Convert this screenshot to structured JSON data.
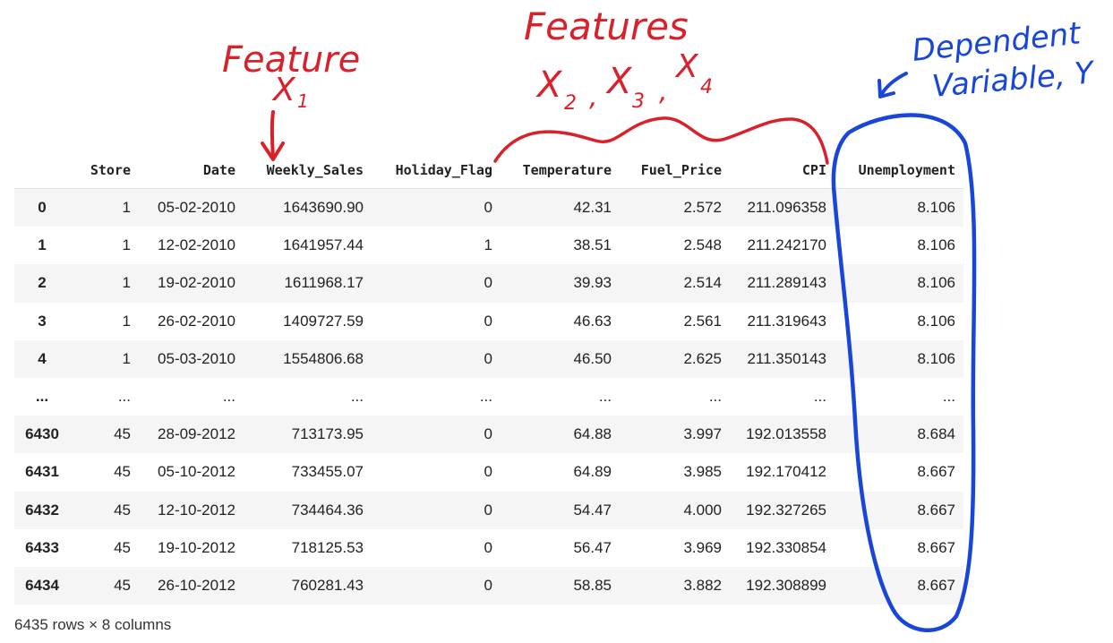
{
  "table": {
    "columns": [
      "",
      "Store",
      "Date",
      "Weekly_Sales",
      "Holiday_Flag",
      "Temperature",
      "Fuel_Price",
      "CPI",
      "Unemployment"
    ],
    "rows": [
      [
        "0",
        "1",
        "05-02-2010",
        "1643690.90",
        "0",
        "42.31",
        "2.572",
        "211.096358",
        "8.106"
      ],
      [
        "1",
        "1",
        "12-02-2010",
        "1641957.44",
        "1",
        "38.51",
        "2.548",
        "211.242170",
        "8.106"
      ],
      [
        "2",
        "1",
        "19-02-2010",
        "1611968.17",
        "0",
        "39.93",
        "2.514",
        "211.289143",
        "8.106"
      ],
      [
        "3",
        "1",
        "26-02-2010",
        "1409727.59",
        "0",
        "46.63",
        "2.561",
        "211.319643",
        "8.106"
      ],
      [
        "4",
        "1",
        "05-03-2010",
        "1554806.68",
        "0",
        "46.50",
        "2.625",
        "211.350143",
        "8.106"
      ],
      [
        "...",
        "...",
        "...",
        "...",
        "...",
        "...",
        "...",
        "...",
        "..."
      ],
      [
        "6430",
        "45",
        "28-09-2012",
        "713173.95",
        "0",
        "64.88",
        "3.997",
        "192.013558",
        "8.684"
      ],
      [
        "6431",
        "45",
        "05-10-2012",
        "733455.07",
        "0",
        "64.89",
        "3.985",
        "192.170412",
        "8.667"
      ],
      [
        "6432",
        "45",
        "12-10-2012",
        "734464.36",
        "0",
        "54.47",
        "4.000",
        "192.327265",
        "8.667"
      ],
      [
        "6433",
        "45",
        "19-10-2012",
        "718125.53",
        "0",
        "56.47",
        "3.969",
        "192.330854",
        "8.667"
      ],
      [
        "6434",
        "45",
        "26-10-2012",
        "760281.43",
        "0",
        "58.85",
        "3.882",
        "192.308899",
        "8.667"
      ]
    ]
  },
  "footer": "6435 rows × 8 columns",
  "annotations": {
    "feature_x1": {
      "line1": "Feature",
      "line2": "X",
      "sub": "1"
    },
    "features_x234": {
      "line1": "Features",
      "x": [
        "X",
        "X",
        "X"
      ],
      "subs": [
        "2",
        "3",
        "4"
      ]
    },
    "dependent": {
      "line1": "Dependent",
      "line2": "Variable, Y"
    },
    "colors": {
      "red": "#d9212b",
      "blue": "#1846d9"
    }
  }
}
